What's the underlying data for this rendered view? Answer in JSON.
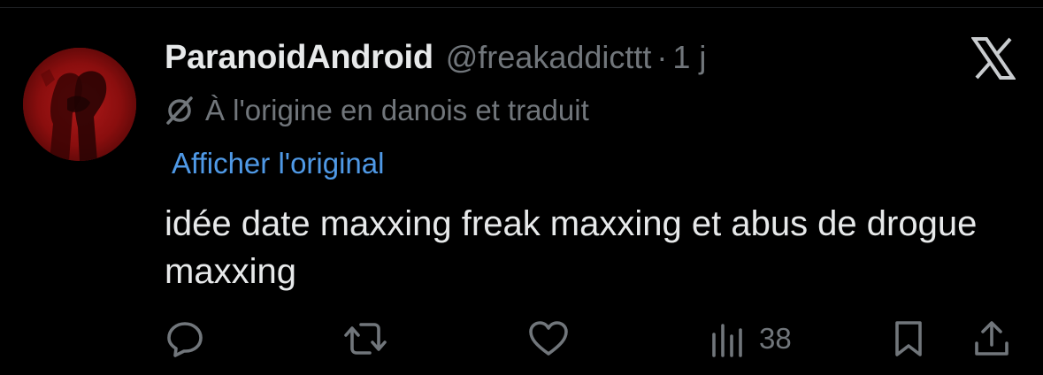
{
  "tweet": {
    "display_name": "ParanoidAndroid",
    "handle": "@freakaddicttt",
    "separator": "·",
    "time": "1 j",
    "translation_note": "À l'origine en danois et traduit",
    "show_original_label": "Afficher l'original",
    "text": "idée date maxxing freak maxxing et abus de drogue maxxing"
  },
  "actions": {
    "reply_icon": "speech-bubble-icon",
    "retweet_icon": "retweet-arrows-icon",
    "like_icon": "heart-icon",
    "views_icon": "bar-chart-icon",
    "views_count": "38",
    "bookmark_icon": "bookmark-icon",
    "share_icon": "share-upload-icon"
  },
  "colors": {
    "background": "#000000",
    "primary_text": "#e7e9ea",
    "secondary_text": "#71767b",
    "link": "#4f99e6",
    "avatar_red": "#a41414"
  }
}
